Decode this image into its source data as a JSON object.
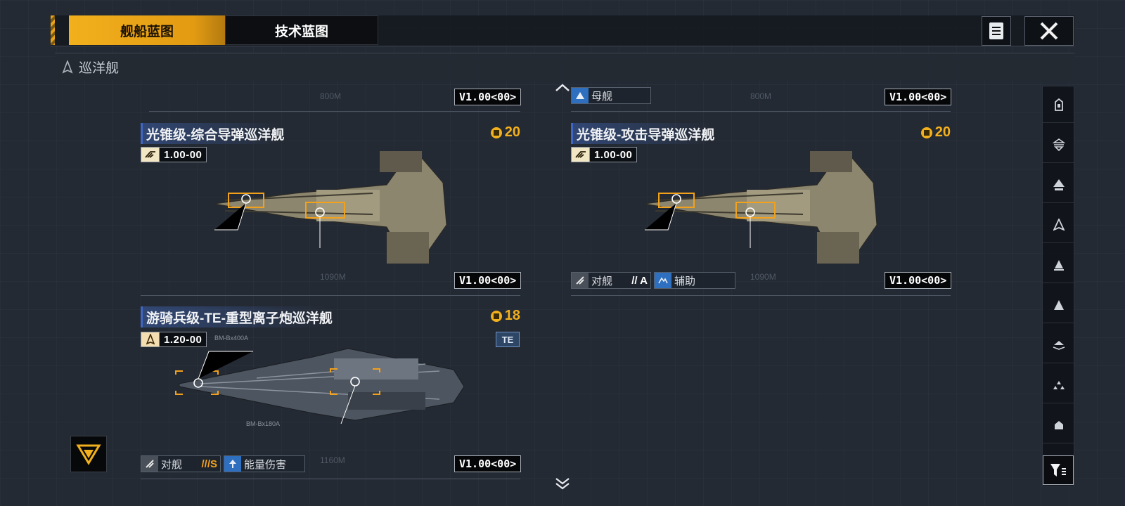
{
  "tabs": [
    {
      "label": "舰船蓝图"
    },
    {
      "label": "技术蓝图"
    }
  ],
  "section": {
    "title": "巡洋舰"
  },
  "top_row": [
    {
      "version": "V1.00<00>",
      "length": "800M"
    },
    {
      "version": "V1.00<00>",
      "length": "800M",
      "tag": "母舰"
    }
  ],
  "cards": [
    {
      "title": "光锥级-综合导弹巡洋舰",
      "cost": "20",
      "badge_value": "1.00-00",
      "version": "V1.00<00>",
      "length": "1090M"
    },
    {
      "title": "光锥级-攻击导弹巡洋舰",
      "cost": "20",
      "badge_value": "1.00-00",
      "version": "V1.00<00>",
      "length": "1090M",
      "role_label": "对舰",
      "role_rank": "// A",
      "support_label": "辅助"
    },
    {
      "title": "游骑兵级-TE-重型离子炮巡洋舰",
      "cost": "18",
      "badge_value": "1.20-00",
      "te_badge": "TE",
      "version": "V1.00<00>",
      "length": "1160M",
      "role_label": "对舰",
      "role_rank": "///S",
      "damage_label": "能量伤害",
      "callout_a": "BM-Bx400A",
      "callout_b": "BM-Bx180A"
    }
  ],
  "rail_icons": [
    "all-ships-icon",
    "carrier-icon",
    "battlecruiser-icon",
    "cruiser-icon",
    "destroyer-icon",
    "frigate-icon",
    "corvette-icon",
    "fighter-icon",
    "auxiliary-icon"
  ],
  "colors": {
    "accent": "#f2b01d",
    "title_bar": "#3f66c3",
    "background": "#242a33"
  }
}
